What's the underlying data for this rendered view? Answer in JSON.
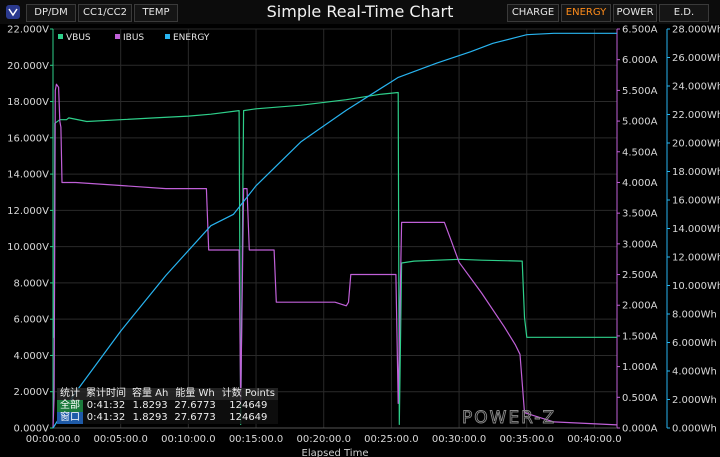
{
  "header": {
    "left_tabs": [
      "DP/DM",
      "CC1/CC2",
      "TEMP"
    ],
    "title": "Simple Real-Time Chart",
    "right_tabs": [
      "CHARGE",
      "ENERGY",
      "POWER",
      "E.D."
    ],
    "active_tab": "ENERGY"
  },
  "colors": {
    "vbus": "#2ecf8a",
    "ibus": "#c060d8",
    "energy": "#28b4f0",
    "active_tab": "#ff8c1a"
  },
  "stats": {
    "headers": [
      "统计",
      "累计时间",
      "容量 Ah",
      "能量 Wh",
      "计数 Points"
    ],
    "rows": [
      [
        "全部",
        "0:41:32",
        "1.8293",
        "27.6773",
        "124649"
      ],
      [
        "窗口",
        "0:41:32",
        "1.8293",
        "27.6773",
        "124649"
      ]
    ]
  },
  "watermark": "POWER-Z",
  "chart_data": {
    "type": "line",
    "title": "Simple Real-Time Chart",
    "xlabel": "Elapsed Time",
    "x_ticks": [
      "00:00:00.0",
      "00:05:00.0",
      "00:10:00.0",
      "00:15:00.0",
      "00:20:00.0",
      "00:25:00.0",
      "00:30:00.0",
      "00:35:00.0",
      "00:40:00.0"
    ],
    "xlim": [
      0,
      2500
    ],
    "grid": true,
    "legend_position": "top-left",
    "axes": [
      {
        "id": "vbus",
        "side": "left",
        "range": [
          0,
          22
        ],
        "ticks": [
          "0.000V",
          "2.000V",
          "4.000V",
          "6.000V",
          "8.000V",
          "10.000V",
          "12.000V",
          "14.000V",
          "16.000V",
          "18.000V",
          "20.000V",
          "22.000V"
        ]
      },
      {
        "id": "ibus",
        "side": "right",
        "range": [
          0,
          6.5
        ],
        "ticks": [
          "0.000A",
          "0.500A",
          "1.000A",
          "1.500A",
          "2.000A",
          "2.500A",
          "3.000A",
          "3.500A",
          "4.000A",
          "4.500A",
          "5.000A",
          "5.500A",
          "6.000A",
          "6.500A"
        ]
      },
      {
        "id": "energy",
        "side": "right",
        "range": [
          0,
          28
        ],
        "ticks": [
          "0.000Wh",
          "2.000Wh",
          "4.000Wh",
          "6.000Wh",
          "8.000Wh",
          "10.000Wh",
          "12.000Wh",
          "14.000Wh",
          "16.000Wh",
          "18.000Wh",
          "20.000Wh",
          "22.000Wh",
          "24.000Wh",
          "26.000Wh",
          "28.000Wh"
        ]
      }
    ],
    "series": [
      {
        "name": "VBUS",
        "axis": "vbus",
        "color": "#2ecf8a",
        "points": [
          [
            0,
            5.0
          ],
          [
            5,
            5.0
          ],
          [
            8,
            16.8
          ],
          [
            30,
            17.0
          ],
          [
            60,
            17.0
          ],
          [
            70,
            17.1
          ],
          [
            150,
            16.9
          ],
          [
            300,
            17.0
          ],
          [
            450,
            17.1
          ],
          [
            600,
            17.2
          ],
          [
            700,
            17.3
          ],
          [
            825,
            17.5
          ],
          [
            832,
            0.2
          ],
          [
            845,
            17.5
          ],
          [
            900,
            17.6
          ],
          [
            1100,
            17.8
          ],
          [
            1300,
            18.1
          ],
          [
            1450,
            18.4
          ],
          [
            1530,
            18.5
          ],
          [
            1535,
            0.2
          ],
          [
            1545,
            9.1
          ],
          [
            1600,
            9.2
          ],
          [
            1800,
            9.3
          ],
          [
            1900,
            9.25
          ],
          [
            2080,
            9.2
          ],
          [
            2090,
            6.1
          ],
          [
            2100,
            5.0
          ],
          [
            2500,
            5.0
          ]
        ]
      },
      {
        "name": "IBUS",
        "axis": "ibus",
        "color": "#c060d8",
        "points": [
          [
            0,
            0.0
          ],
          [
            5,
            0.5
          ],
          [
            10,
            5.5
          ],
          [
            15,
            5.6
          ],
          [
            25,
            5.55
          ],
          [
            30,
            5.0
          ],
          [
            35,
            4.9
          ],
          [
            40,
            4.0
          ],
          [
            100,
            4.0
          ],
          [
            300,
            3.95
          ],
          [
            500,
            3.9
          ],
          [
            680,
            3.9
          ],
          [
            690,
            2.9
          ],
          [
            825,
            2.9
          ],
          [
            832,
            0.4
          ],
          [
            845,
            3.9
          ],
          [
            860,
            3.9
          ],
          [
            870,
            2.9
          ],
          [
            980,
            2.9
          ],
          [
            990,
            2.05
          ],
          [
            1150,
            2.05
          ],
          [
            1250,
            2.05
          ],
          [
            1300,
            1.99
          ],
          [
            1310,
            2.05
          ],
          [
            1320,
            2.5
          ],
          [
            1520,
            2.5
          ],
          [
            1530,
            0.4
          ],
          [
            1545,
            3.35
          ],
          [
            1700,
            3.35
          ],
          [
            1735,
            3.35
          ],
          [
            1760,
            3.1
          ],
          [
            1800,
            2.7
          ],
          [
            1900,
            2.2
          ],
          [
            2000,
            1.65
          ],
          [
            2050,
            1.35
          ],
          [
            2070,
            1.2
          ],
          [
            2090,
            0.25
          ],
          [
            2220,
            0.1
          ],
          [
            2500,
            0.05
          ]
        ]
      },
      {
        "name": "ENERGY",
        "axis": "energy",
        "color": "#28b4f0",
        "points": [
          [
            0,
            0.0
          ],
          [
            100,
            2.5
          ],
          [
            300,
            6.8
          ],
          [
            500,
            10.7
          ],
          [
            700,
            14.2
          ],
          [
            800,
            15.0
          ],
          [
            900,
            17.0
          ],
          [
            1100,
            20.1
          ],
          [
            1300,
            22.3
          ],
          [
            1500,
            24.3
          ],
          [
            1530,
            24.6
          ],
          [
            1700,
            25.6
          ],
          [
            1850,
            26.4
          ],
          [
            1950,
            27.0
          ],
          [
            2050,
            27.4
          ],
          [
            2100,
            27.6
          ],
          [
            2220,
            27.7
          ],
          [
            2500,
            27.7
          ]
        ]
      }
    ]
  }
}
